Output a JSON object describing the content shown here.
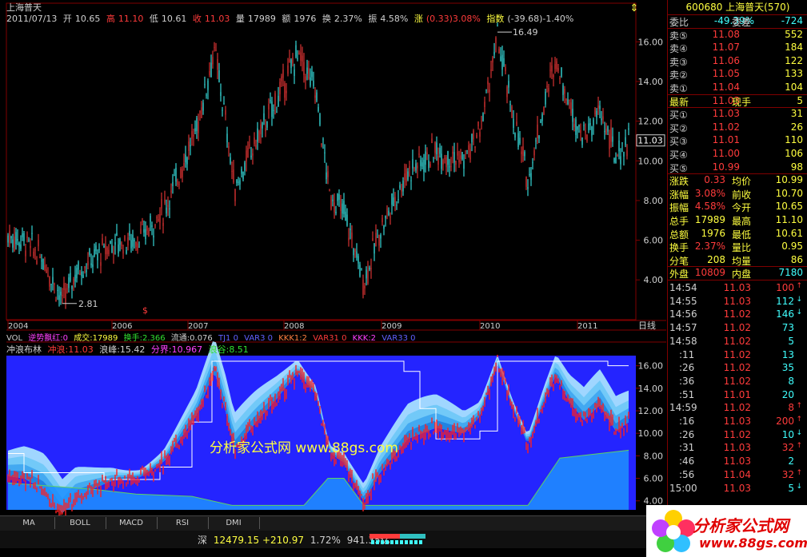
{
  "header": {
    "stock_name": "上海普天",
    "date": "2011/07/13",
    "open_label": "开",
    "open": "10.65",
    "high_label": "高",
    "high": "11.10",
    "low_label": "低",
    "low": "10.61",
    "close_label": "收",
    "close": "11.03",
    "vol_label": "量",
    "vol": "17989",
    "amount_label": "额",
    "amount": "1976",
    "turnover_label": "换",
    "turnover": "2.37%",
    "amplitude_label": "振",
    "amplitude": "4.58%",
    "change_label": "涨",
    "change": "(0.33)3.08%",
    "index_label": "指数",
    "index": "(-39.68)-1.40%"
  },
  "main_chart": {
    "y_ticks": [
      "16.00",
      "14.00",
      "12.00",
      "10.00",
      "8.00",
      "6.00",
      "4.00"
    ],
    "x_ticks": [
      "2004",
      "2006",
      "2007",
      "2008",
      "2009",
      "2010",
      "2011"
    ],
    "period_label": "日线",
    "max_mark": "16.49",
    "min_mark": "2.81",
    "last_price_tag": "11.03"
  },
  "indicator_row": {
    "vol": "VOL",
    "nizhi": "逆势飘红:0",
    "chengjiao": "成交:17989",
    "huanshou": "换手:2.366",
    "liutong": "流通:0.076",
    "tj1": "TJ1 0",
    "var3": "VAR3 0",
    "kkk1": "KKK1:2",
    "var31": "VAR31 0",
    "kkk2": "KKK:2",
    "var33": "VAR33 0"
  },
  "lower_panel": {
    "title": "冲浪布林",
    "chonglang": "冲浪:11.03",
    "langfeng": "浪峰:15.42",
    "fenjie": "分界:10.967",
    "langgu": "浪谷:8.51",
    "y_ticks": [
      "16.00",
      "14.00",
      "12.00",
      "10.00",
      "8.00",
      "6.00",
      "4.00"
    ],
    "watermark": "分析家公式网 www.88gs.com"
  },
  "right_panel": {
    "code_title": "600680 上海普天(570)",
    "weibi_label": "委比",
    "weibi": "-49.39%",
    "weicha_label": "委差",
    "weicha": "-724",
    "asks": [
      {
        "label": "卖⑤",
        "price": "11.08",
        "vol": "552"
      },
      {
        "label": "卖④",
        "price": "11.07",
        "vol": "184"
      },
      {
        "label": "卖③",
        "price": "11.06",
        "vol": "122"
      },
      {
        "label": "卖②",
        "price": "11.05",
        "vol": "133"
      },
      {
        "label": "卖①",
        "price": "11.04",
        "vol": "104"
      }
    ],
    "latest_label": "最新",
    "latest": "11.03",
    "xianshou_label": "现手",
    "xianshou": "5",
    "bids": [
      {
        "label": "买①",
        "price": "11.03",
        "vol": "31"
      },
      {
        "label": "买②",
        "price": "11.02",
        "vol": "26"
      },
      {
        "label": "买③",
        "price": "11.01",
        "vol": "110"
      },
      {
        "label": "买④",
        "price": "11.00",
        "vol": "106"
      },
      {
        "label": "买⑤",
        "price": "10.99",
        "vol": "98"
      }
    ],
    "stats": [
      {
        "l1": "涨跌",
        "v1": "0.33",
        "l2": "均价",
        "v2": "10.99"
      },
      {
        "l1": "涨幅",
        "v1": "3.08%",
        "l2": "前收",
        "v2": "10.70"
      },
      {
        "l1": "振幅",
        "v1": "4.58%",
        "l2": "今开",
        "v2": "10.65"
      },
      {
        "l1": "总手",
        "v1": "17989",
        "l2": "最高",
        "v2": "11.10"
      },
      {
        "l1": "总额",
        "v1": "1976",
        "l2": "最低",
        "v2": "10.61"
      },
      {
        "l1": "换手",
        "v1": "2.37%",
        "l2": "量比",
        "v2": "0.95"
      },
      {
        "l1": "分笔",
        "v1": "208",
        "l2": "均量",
        "v2": "86"
      }
    ],
    "waipan_label": "外盘",
    "waipan": "10809",
    "neipan_label": "内盘",
    "neipan": "7180",
    "ticks": [
      {
        "t": "14:54",
        "p": "11.03",
        "v": "100",
        "a": "↑"
      },
      {
        "t": "14:55",
        "p": "11.03",
        "v": "112",
        "a": "↓"
      },
      {
        "t": "14:56",
        "p": "11.02",
        "v": "146",
        "a": "↓"
      },
      {
        "t": "14:57",
        "p": "11.02",
        "v": "73",
        "a": ""
      },
      {
        "t": "14:58",
        "p": "11.02",
        "v": "5",
        "a": ""
      },
      {
        "t": ":11",
        "p": "11.02",
        "v": "13",
        "a": ""
      },
      {
        "t": ":26",
        "p": "11.02",
        "v": "35",
        "a": ""
      },
      {
        "t": ":36",
        "p": "11.02",
        "v": "8",
        "a": ""
      },
      {
        "t": ":51",
        "p": "11.01",
        "v": "20",
        "a": ""
      },
      {
        "t": "14:59",
        "p": "11.02",
        "v": "8",
        "a": "↑"
      },
      {
        "t": ":16",
        "p": "11.03",
        "v": "200",
        "a": "↑"
      },
      {
        "t": ":26",
        "p": "11.02",
        "v": "10",
        "a": "↓"
      },
      {
        "t": ":31",
        "p": "11.03",
        "v": "32",
        "a": "↑"
      },
      {
        "t": ":46",
        "p": "11.03",
        "v": "2",
        "a": ""
      },
      {
        "t": ":56",
        "p": "11.04",
        "v": "32",
        "a": "↑"
      },
      {
        "t": "15:00",
        "p": "11.03",
        "v": "5",
        "a": "↓"
      }
    ]
  },
  "tabs": [
    "MA",
    "BOLL",
    "MACD",
    "RSI",
    "DMI"
  ],
  "status": {
    "market": "深",
    "index": "12479.15",
    "change": "+210.97",
    "pct": "1.72%",
    "amount": "941.35亿"
  },
  "logo": {
    "line1": "分析家公式网",
    "line2": "www.88gs.com"
  },
  "colors": {
    "up": "#ff3b3b",
    "down": "#40ffff",
    "band": "#2020ff",
    "frame": "#800000"
  }
}
